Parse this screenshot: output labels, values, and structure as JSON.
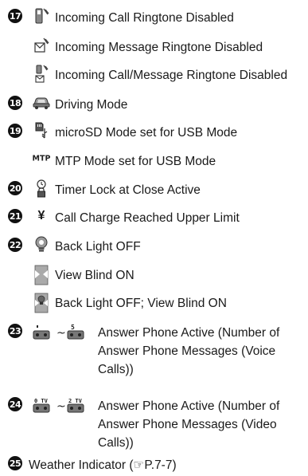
{
  "items": [
    {
      "number": "17",
      "label": "Incoming Call Ringtone Disabled"
    },
    {
      "number": "",
      "label": "Incoming Message Ringtone Disabled"
    },
    {
      "number": "",
      "label": "Incoming Call/Message Ringtone Disabled"
    },
    {
      "number": "18",
      "label": "Driving Mode"
    },
    {
      "number": "19",
      "label": "microSD Mode set for USB Mode"
    },
    {
      "number": "",
      "label": "MTP Mode set for USB Mode",
      "icon_text": "MTP"
    },
    {
      "number": "20",
      "label": "Timer Lock at Close Active"
    },
    {
      "number": "21",
      "label": "Call Charge Reached Upper Limit",
      "icon_text": "¥"
    },
    {
      "number": "22",
      "label": "Back Light OFF"
    },
    {
      "number": "",
      "label": "View Blind ON"
    },
    {
      "number": "",
      "label": "Back Light OFF; View Blind ON"
    },
    {
      "number": "23",
      "label": "Answer Phone Active (Number of Answer Phone Messages (Voice Calls))",
      "icon_top": "",
      "icon_top_right": "5",
      "separator": "~"
    },
    {
      "number": "24",
      "label": "Answer Phone Active (Number of Answer Phone Messages (Video Calls))",
      "icon_top": "0 TV",
      "icon_top_right": "2 TV",
      "separator": "~"
    },
    {
      "number": "25",
      "label": "Weather Indicator (☞P.7-7)"
    }
  ]
}
